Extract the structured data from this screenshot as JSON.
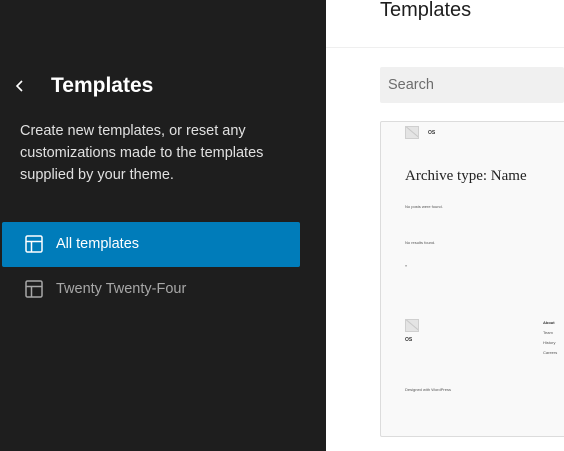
{
  "sidebar": {
    "title": "Templates",
    "description": "Create new templates, or reset any customizations made to the templates supplied by your theme.",
    "nav": [
      {
        "label": "All templates",
        "active": true
      },
      {
        "label": "Twenty Twenty-Four",
        "active": false
      }
    ]
  },
  "main": {
    "title": "Templates",
    "search": {
      "placeholder": "Search",
      "value": ""
    },
    "preview": {
      "header_site": "OS",
      "heading": "Archive type: Name",
      "empty_text": "No posts were found.",
      "empty_text_2": "No results found.",
      "pagination": "«",
      "footer_site": "OS",
      "footer_menu": [
        "About",
        "Team",
        "History",
        "Careers"
      ],
      "credit": "Designed with WordPress"
    }
  },
  "colors": {
    "sidebar_bg": "#1e1e1e",
    "accent": "#007cba",
    "main_bg": "#ffffff"
  }
}
